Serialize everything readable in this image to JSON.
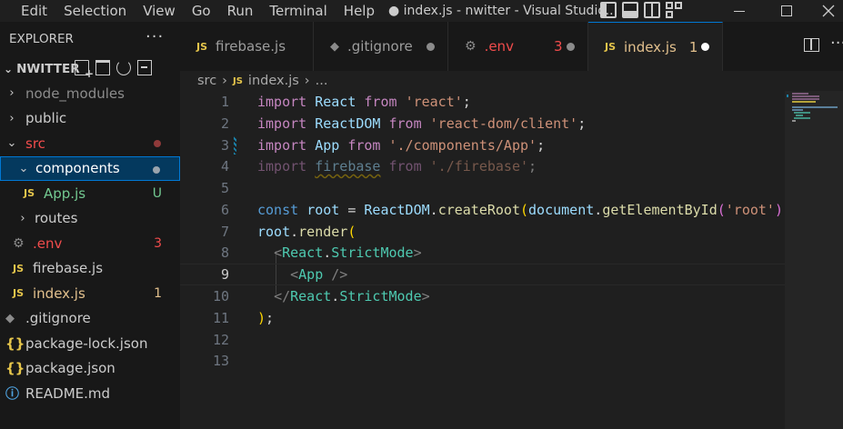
{
  "titlebar": {
    "menus": [
      "Edit",
      "Selection",
      "View",
      "Go",
      "Run",
      "Terminal",
      "Help"
    ],
    "title": "● index.js - nwitter - Visual Studio..."
  },
  "sidebar": {
    "header": "EXPLORER",
    "more": "···",
    "project": "NWITTER",
    "items": [
      {
        "label": "node_modules",
        "chevron": "›",
        "icon": "",
        "status": ""
      },
      {
        "label": "public",
        "chevron": "›",
        "icon": "",
        "status": ""
      },
      {
        "label": "src",
        "chevron": "⌄",
        "icon": "",
        "status": "dot-red"
      },
      {
        "label": "components",
        "chevron": "⌄",
        "icon": "",
        "status": "dot-gray"
      },
      {
        "label": "App.js",
        "chevron": "",
        "icon": "JS",
        "status": "U"
      },
      {
        "label": "routes",
        "chevron": "›",
        "icon": "",
        "status": ""
      },
      {
        "label": ".env",
        "chevron": "",
        "icon": "gear",
        "status": "3"
      },
      {
        "label": "firebase.js",
        "chevron": "",
        "icon": "JS",
        "status": ""
      },
      {
        "label": "index.js",
        "chevron": "",
        "icon": "JS",
        "status": "1"
      },
      {
        "label": ".gitignore",
        "chevron": "",
        "icon": "diamond",
        "status": ""
      },
      {
        "label": "package-lock.json",
        "chevron": "",
        "icon": "{}",
        "status": ""
      },
      {
        "label": "package.json",
        "chevron": "",
        "icon": "{}",
        "status": ""
      },
      {
        "label": "README.md",
        "chevron": "",
        "icon": "info",
        "status": ""
      }
    ]
  },
  "tabs": [
    {
      "label": "firebase.js",
      "icon": "JS"
    },
    {
      "label": ".gitignore",
      "icon": "diamond"
    },
    {
      "label": ".env",
      "icon": "gear",
      "count": "3"
    },
    {
      "label": "index.js",
      "icon": "JS",
      "count": "1"
    }
  ],
  "breadcrumb": {
    "folder": "src",
    "file": "index.js",
    "more": "..."
  },
  "editor": {
    "line_numbers": [
      "1",
      "2",
      "3",
      "4",
      "5",
      "6",
      "7",
      "8",
      "9",
      "10",
      "11",
      "12",
      "13"
    ],
    "current_line": "9"
  },
  "colors": {
    "accent": "#0078d4",
    "selection": "#04395e",
    "error": "#f14c4c",
    "untracked": "#73c991",
    "modified": "#e2c08d"
  }
}
